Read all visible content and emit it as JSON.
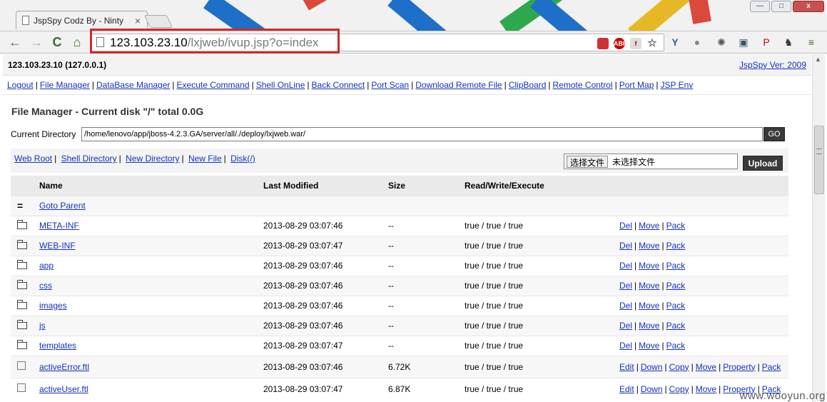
{
  "browser": {
    "tab_title": "JspSpy Codz By - Ninty",
    "tab_close": "×",
    "url_host": "123.103.23.10",
    "url_path": "/lxjweb/ivup.jsp?o=index",
    "window_buttons": {
      "minimize": "—",
      "maximize": "□",
      "close": "x"
    },
    "nav_icons": {
      "back": "←",
      "forward": "→",
      "reload": "C",
      "home": "⌂"
    },
    "extension_icons": [
      "stop-icon",
      "adblock-icon",
      "flash-icon",
      "star-icon",
      "yandex-icon",
      "globe-icon",
      "gear-icon",
      "translate-icon",
      "pinterest-icon",
      "evernote-icon",
      "menu-icon"
    ]
  },
  "header": {
    "ip": "123.103.23.10 (127.0.0.1)",
    "version_link": "JspSpy Ver: 2009"
  },
  "nav": [
    "Logout",
    "File Manager",
    "DataBase Manager",
    "Execute Command",
    "Shell OnLine",
    "Back Connect",
    "Port Scan",
    "Download Remote File",
    "ClipBoard",
    "Remote Control",
    "Port Map",
    "JSP Env"
  ],
  "file_manager": {
    "title": "File Manager - Current disk \"/\" total 0.0G",
    "current_dir_label": "Current Directory",
    "current_dir_value": "/home/lenovo/app/jboss-4.2.3.GA/server/all/./deploy/lxjweb.war/",
    "go_label": "GO",
    "tool_links": [
      "Web Root",
      "Shell Directory",
      "New Directory",
      "New File",
      "Disk(/)"
    ],
    "choose_file_label": "选择文件",
    "no_file_label": "未选择文件",
    "upload_label": "Upload"
  },
  "table": {
    "headers": [
      "Name",
      "Last Modified",
      "Size",
      "Read/Write/Execute"
    ],
    "parent_icon": "=",
    "parent_label": "Goto Parent",
    "dir_actions": [
      "Del",
      "Move",
      "Pack"
    ],
    "file_actions": [
      "Edit",
      "Down",
      "Copy",
      "Move",
      "Property",
      "Pack"
    ],
    "dirs": [
      {
        "name": "META-INF",
        "modified": "2013-08-29 03:07:46",
        "size": "--",
        "rwx": "true / true / true"
      },
      {
        "name": "WEB-INF",
        "modified": "2013-08-29 03:07:47",
        "size": "--",
        "rwx": "true / true / true"
      },
      {
        "name": "app",
        "modified": "2013-08-29 03:07:46",
        "size": "--",
        "rwx": "true / true / true"
      },
      {
        "name": "css",
        "modified": "2013-08-29 03:07:46",
        "size": "--",
        "rwx": "true / true / true"
      },
      {
        "name": "images",
        "modified": "2013-08-29 03:07:46",
        "size": "--",
        "rwx": "true / true / true"
      },
      {
        "name": "js",
        "modified": "2013-08-29 03:07:46",
        "size": "--",
        "rwx": "true / true / true"
      },
      {
        "name": "templates",
        "modified": "2013-08-29 03:07:47",
        "size": "--",
        "rwx": "true / true / true"
      }
    ],
    "files": [
      {
        "name": "activeError.ftl",
        "modified": "2013-08-29 03:07:46",
        "size": "6.72K",
        "rwx": "true / true / true"
      },
      {
        "name": "activeUser.ftl",
        "modified": "2013-08-29 03:07:47",
        "size": "6.87K",
        "rwx": "true / true / true"
      }
    ]
  },
  "watermark": "www.wooyun.org",
  "colors": {
    "link": "#1133bb",
    "highlight": "#d12a2a",
    "button_dark": "#3a3a3a"
  }
}
